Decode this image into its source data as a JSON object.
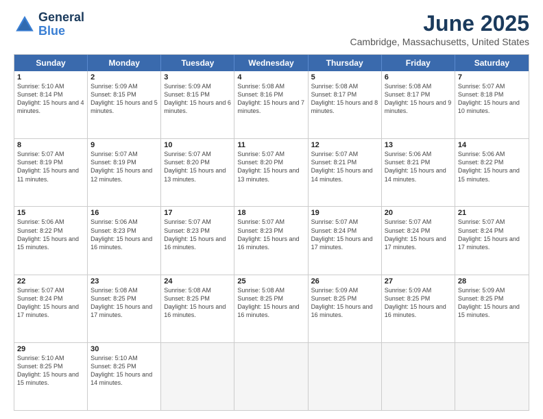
{
  "app": {
    "name": "GeneralBlue",
    "name_line1": "General",
    "name_line2": "Blue"
  },
  "calendar": {
    "title": "June 2025",
    "subtitle": "Cambridge, Massachusetts, United States",
    "headers": [
      "Sunday",
      "Monday",
      "Tuesday",
      "Wednesday",
      "Thursday",
      "Friday",
      "Saturday"
    ],
    "rows": [
      [
        {
          "day": "1",
          "sunrise": "5:10 AM",
          "sunset": "8:14 PM",
          "daylight": "15 hours and 4 minutes."
        },
        {
          "day": "2",
          "sunrise": "5:09 AM",
          "sunset": "8:15 PM",
          "daylight": "15 hours and 5 minutes."
        },
        {
          "day": "3",
          "sunrise": "5:09 AM",
          "sunset": "8:15 PM",
          "daylight": "15 hours and 6 minutes."
        },
        {
          "day": "4",
          "sunrise": "5:08 AM",
          "sunset": "8:16 PM",
          "daylight": "15 hours and 7 minutes."
        },
        {
          "day": "5",
          "sunrise": "5:08 AM",
          "sunset": "8:17 PM",
          "daylight": "15 hours and 8 minutes."
        },
        {
          "day": "6",
          "sunrise": "5:08 AM",
          "sunset": "8:17 PM",
          "daylight": "15 hours and 9 minutes."
        },
        {
          "day": "7",
          "sunrise": "5:07 AM",
          "sunset": "8:18 PM",
          "daylight": "15 hours and 10 minutes."
        }
      ],
      [
        {
          "day": "8",
          "sunrise": "5:07 AM",
          "sunset": "8:19 PM",
          "daylight": "15 hours and 11 minutes."
        },
        {
          "day": "9",
          "sunrise": "5:07 AM",
          "sunset": "8:19 PM",
          "daylight": "15 hours and 12 minutes."
        },
        {
          "day": "10",
          "sunrise": "5:07 AM",
          "sunset": "8:20 PM",
          "daylight": "15 hours and 13 minutes."
        },
        {
          "day": "11",
          "sunrise": "5:07 AM",
          "sunset": "8:20 PM",
          "daylight": "15 hours and 13 minutes."
        },
        {
          "day": "12",
          "sunrise": "5:07 AM",
          "sunset": "8:21 PM",
          "daylight": "15 hours and 14 minutes."
        },
        {
          "day": "13",
          "sunrise": "5:06 AM",
          "sunset": "8:21 PM",
          "daylight": "15 hours and 14 minutes."
        },
        {
          "day": "14",
          "sunrise": "5:06 AM",
          "sunset": "8:22 PM",
          "daylight": "15 hours and 15 minutes."
        }
      ],
      [
        {
          "day": "15",
          "sunrise": "5:06 AM",
          "sunset": "8:22 PM",
          "daylight": "15 hours and 15 minutes."
        },
        {
          "day": "16",
          "sunrise": "5:06 AM",
          "sunset": "8:23 PM",
          "daylight": "15 hours and 16 minutes."
        },
        {
          "day": "17",
          "sunrise": "5:07 AM",
          "sunset": "8:23 PM",
          "daylight": "15 hours and 16 minutes."
        },
        {
          "day": "18",
          "sunrise": "5:07 AM",
          "sunset": "8:23 PM",
          "daylight": "15 hours and 16 minutes."
        },
        {
          "day": "19",
          "sunrise": "5:07 AM",
          "sunset": "8:24 PM",
          "daylight": "15 hours and 17 minutes."
        },
        {
          "day": "20",
          "sunrise": "5:07 AM",
          "sunset": "8:24 PM",
          "daylight": "15 hours and 17 minutes."
        },
        {
          "day": "21",
          "sunrise": "5:07 AM",
          "sunset": "8:24 PM",
          "daylight": "15 hours and 17 minutes."
        }
      ],
      [
        {
          "day": "22",
          "sunrise": "5:07 AM",
          "sunset": "8:24 PM",
          "daylight": "15 hours and 17 minutes."
        },
        {
          "day": "23",
          "sunrise": "5:08 AM",
          "sunset": "8:25 PM",
          "daylight": "15 hours and 17 minutes."
        },
        {
          "day": "24",
          "sunrise": "5:08 AM",
          "sunset": "8:25 PM",
          "daylight": "15 hours and 16 minutes."
        },
        {
          "day": "25",
          "sunrise": "5:08 AM",
          "sunset": "8:25 PM",
          "daylight": "15 hours and 16 minutes."
        },
        {
          "day": "26",
          "sunrise": "5:09 AM",
          "sunset": "8:25 PM",
          "daylight": "15 hours and 16 minutes."
        },
        {
          "day": "27",
          "sunrise": "5:09 AM",
          "sunset": "8:25 PM",
          "daylight": "15 hours and 16 minutes."
        },
        {
          "day": "28",
          "sunrise": "5:09 AM",
          "sunset": "8:25 PM",
          "daylight": "15 hours and 15 minutes."
        }
      ],
      [
        {
          "day": "29",
          "sunrise": "5:10 AM",
          "sunset": "8:25 PM",
          "daylight": "15 hours and 15 minutes."
        },
        {
          "day": "30",
          "sunrise": "5:10 AM",
          "sunset": "8:25 PM",
          "daylight": "15 hours and 14 minutes."
        },
        {
          "day": "",
          "sunrise": "",
          "sunset": "",
          "daylight": ""
        },
        {
          "day": "",
          "sunrise": "",
          "sunset": "",
          "daylight": ""
        },
        {
          "day": "",
          "sunrise": "",
          "sunset": "",
          "daylight": ""
        },
        {
          "day": "",
          "sunrise": "",
          "sunset": "",
          "daylight": ""
        },
        {
          "day": "",
          "sunrise": "",
          "sunset": "",
          "daylight": ""
        }
      ]
    ]
  }
}
